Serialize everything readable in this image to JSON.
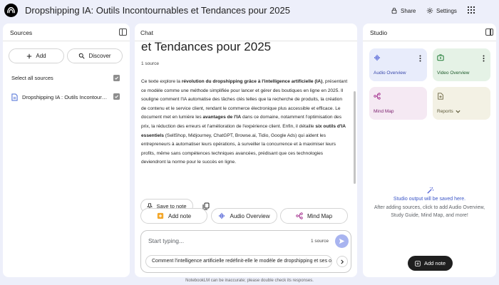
{
  "header": {
    "title": "Dropshipping IA: Outils Incontournables et Tendances pour 2025",
    "share_label": "Share",
    "settings_label": "Settings"
  },
  "sources": {
    "title": "Sources",
    "add_label": "Add",
    "discover_label": "Discover",
    "select_all_label": "Select all sources",
    "items": [
      {
        "name": "Dropshipping IA : Outils Incontournab...",
        "checked": true
      }
    ]
  },
  "chat": {
    "title": "Chat",
    "heading": "et Tendances pour 2025",
    "source_count": "1 source",
    "summary": {
      "p1": "Ce texte explore la ",
      "b1": "révolution du dropshipping grâce à l'intelligence artificielle (IA)",
      "p2": ", présentant ce modèle comme une méthode simplifiée pour lancer et gérer des boutiques en ligne en 2025. Il souligne comment l'IA automatise des tâches clés telles que la recherche de produits, la création de contenu et le service client, rendant le commerce électronique plus accessible et efficace. Le document met en lumière les ",
      "b2": "avantages de l'IA",
      "p3": " dans ce domaine, notamment l'optimisation des prix, la réduction des erreurs et l'amélioration de l'expérience client. Enfin, il détaille ",
      "b3": "six outils d'IA essentiels",
      "p4": " (SellShop, Midjourney, ChatGPT, Browse.ai, Tidio, Google Ads) qui aident les entrepreneurs à automatiser leurs opérations, à surveiller la concurrence et à maximiser leurs profits, même sans compétences techniques avancées, prédisant que ces technologies deviendront la norme pour le succès en ligne."
    },
    "save_note_label": "Save to note",
    "chips": {
      "add_note": "Add note",
      "audio_overview": "Audio Overview",
      "mind_map": "Mind Map"
    },
    "composer": {
      "placeholder": "Start typing...",
      "source_count": "1 source",
      "suggestion": "Comment l'intelligence artificielle redéfinit-elle le modèle de dropshipping et ses op"
    }
  },
  "studio": {
    "title": "Studio",
    "tiles": {
      "audio": "Audio Overview",
      "video": "Video Overview",
      "mind_map": "Mind Map",
      "reports": "Reports"
    },
    "empty_title": "Studio output will be saved here.",
    "empty_desc": "After adding sources, click to add Audio Overview, Study Guide, Mind Map, and more!",
    "add_note_label": "Add note"
  },
  "footer": {
    "disclaimer": "NotebookLM can be inaccurate; please double check its responses."
  },
  "colors": {
    "background": "#edeffa",
    "accent": "#3b56c7",
    "send_button": "#a8b4f0"
  }
}
